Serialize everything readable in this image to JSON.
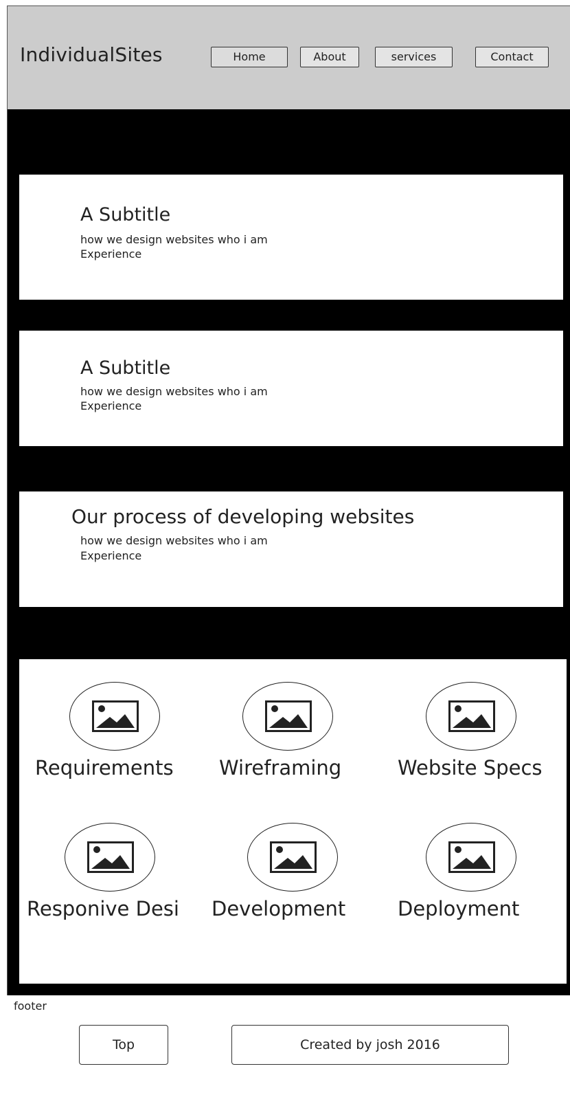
{
  "header": {
    "brand": "IndividualSites",
    "nav": [
      "Home",
      "About",
      "services",
      "Contact"
    ]
  },
  "panels": [
    {
      "title": "A Subtitle",
      "line1": "how we design websites who i am",
      "line2": "Experience"
    },
    {
      "title": "A Subtitle",
      "line1": "how we design websites who i am",
      "line2": "Experience"
    },
    {
      "title": "Our process of developing websites",
      "line1": "how we design websites who i am",
      "line2": "Experience"
    }
  ],
  "process": {
    "steps": [
      {
        "label": "Requirements",
        "icon": "image-icon"
      },
      {
        "label": "Wireframing",
        "icon": "image-icon"
      },
      {
        "label": "Website Specs",
        "icon": "image-icon"
      },
      {
        "label": "Responive Desi",
        "icon": "image-icon"
      },
      {
        "label": "Development",
        "icon": "image-icon"
      },
      {
        "label": "Deployment",
        "icon": "image-icon"
      }
    ]
  },
  "footer": {
    "label": "footer",
    "top_button": "Top",
    "credit": "Created by josh 2016"
  },
  "colors": {
    "header_bg": "#cccccc",
    "page_bg": "#000000",
    "panel_bg": "#ffffff"
  }
}
